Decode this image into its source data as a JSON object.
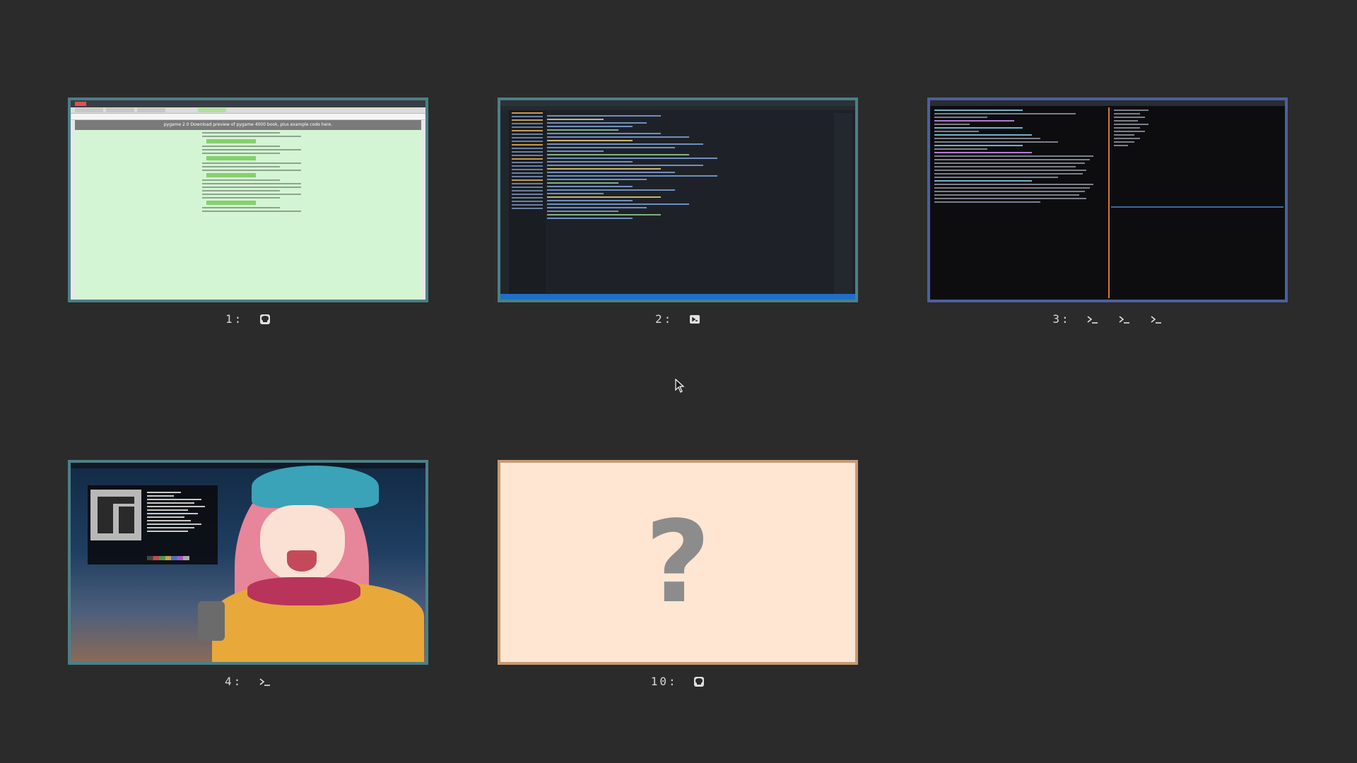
{
  "workspaces": [
    {
      "label": "1:",
      "icons": [
        "github-icon"
      ]
    },
    {
      "label": "2:",
      "icons": [
        "vscode-icon"
      ]
    },
    {
      "label": "3:",
      "icons": [
        "terminal-icon",
        "terminal-icon",
        "terminal-icon"
      ]
    },
    {
      "label": "4:",
      "icons": [
        "terminal-icon"
      ]
    },
    {
      "label": "10:",
      "icons": [
        "github-icon"
      ]
    }
  ],
  "ws1": {
    "page_title": "pygame 2.0 Download preview of pygame 4000 book, plus example code here."
  },
  "ws10": {
    "placeholder": "?"
  },
  "colors": {
    "background": "#2b2b2b",
    "border_default": "#4a8087",
    "border_ws3": "#4c5f9e",
    "border_empty": "#c59a71",
    "empty_fill": "#ffe6d2",
    "placeholder": "#8c8c8c"
  }
}
